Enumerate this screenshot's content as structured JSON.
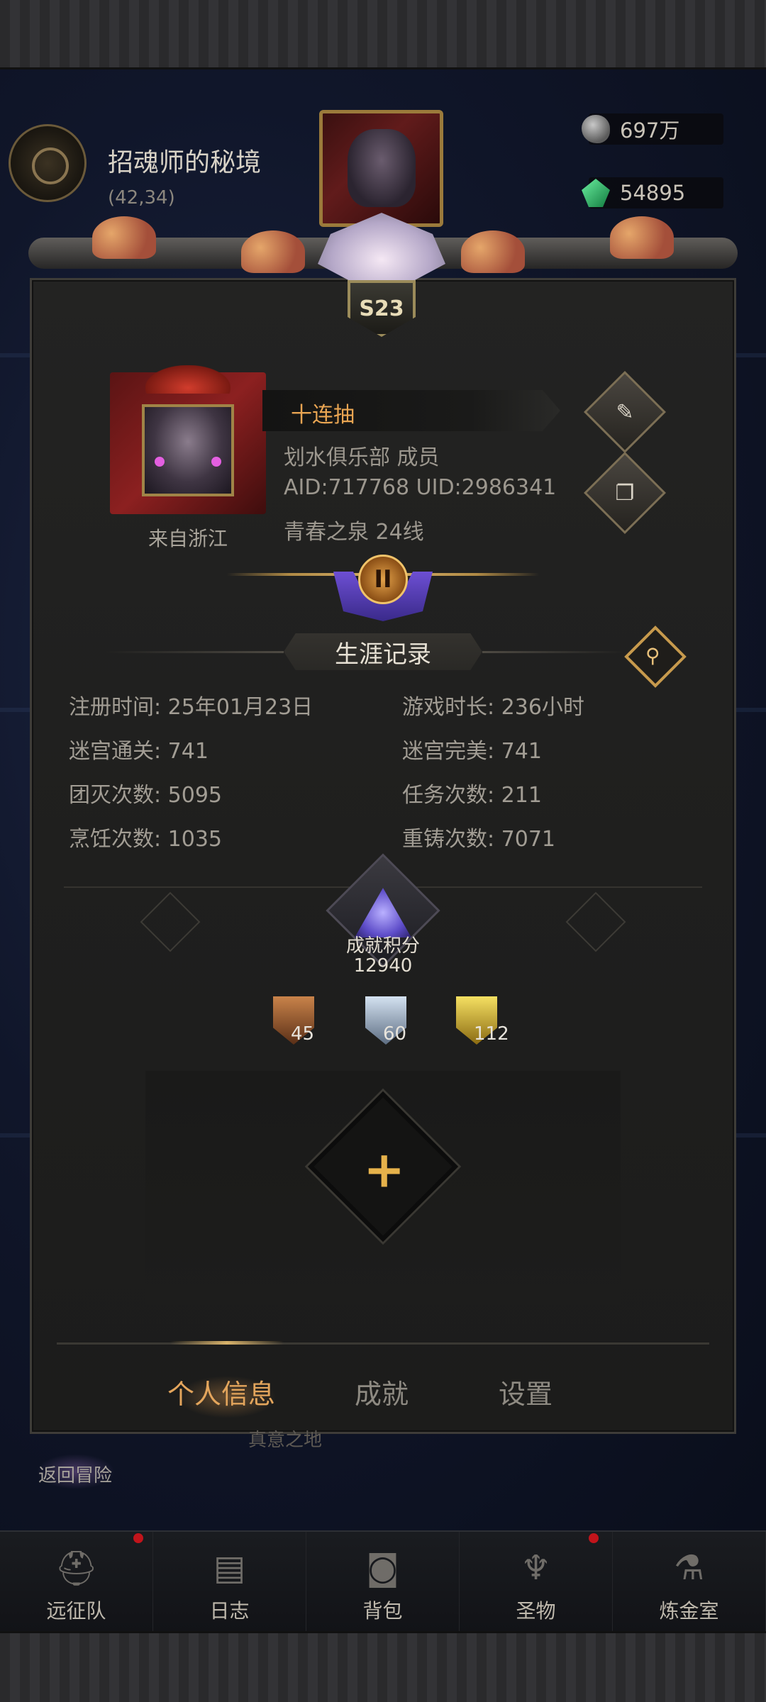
{
  "map": {
    "title": "招魂师的秘境",
    "coords": "(42,34)"
  },
  "currency": [
    {
      "icon": "stone-icon",
      "value": "697万"
    },
    {
      "icon": "emerald-icon",
      "value": "54895"
    }
  ],
  "season_badge": "S23",
  "profile": {
    "name": "十连抽",
    "guild_line": "划水俱乐部  成员",
    "ids_line": "AID:717768 UID:2986341",
    "server_line": "青春之泉  24线",
    "from": "来自浙江",
    "rank_numeral": "II"
  },
  "career": {
    "title": "生涯记录",
    "stats": [
      "注册时间: 25年01月23日",
      "游戏时长: 236小时",
      "迷宫通关: 741",
      "迷宫完美: 741",
      "团灭次数: 5095",
      "任务次数: 211",
      "烹饪次数: 1035",
      "重铸次数: 7071"
    ]
  },
  "achievement": {
    "label": "成就积分",
    "score": "12940",
    "medals": [
      {
        "type": "bronze",
        "count": "45"
      },
      {
        "type": "silver",
        "count": "60"
      },
      {
        "type": "gold",
        "count": "112"
      }
    ]
  },
  "tabs": [
    "个人信息",
    "成就",
    "设置"
  ],
  "active_tab": "个人信息",
  "return_label": "返回冒险",
  "behind_label": "真意之地",
  "bottom_nav": [
    "远征队",
    "日志",
    "背包",
    "圣物",
    "炼金室"
  ],
  "colors": {
    "accent_gold": "#e3a55c",
    "name_orange": "#e9a552",
    "panel_bg": "#222221",
    "notification_red": "#c1141b"
  }
}
